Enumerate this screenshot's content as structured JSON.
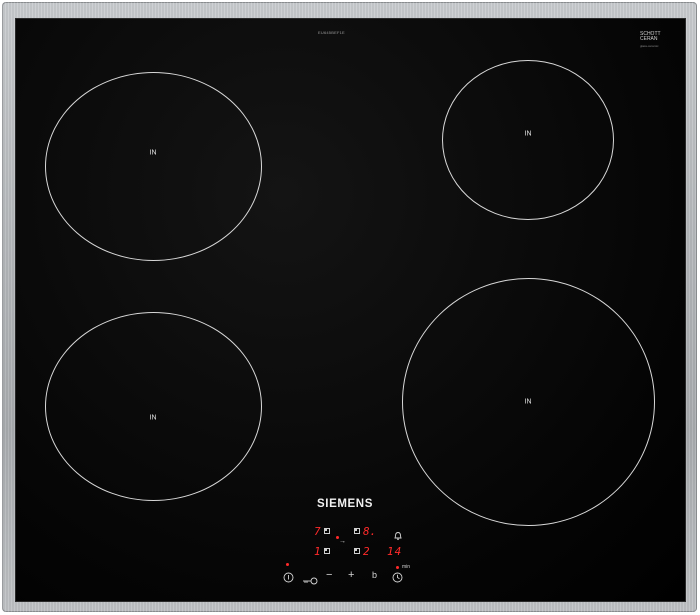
{
  "model_number": "EU645BEF1E",
  "glass_brand": {
    "line1": "SCHOTT",
    "line2": "CERAN",
    "line3": "glass-ceramic"
  },
  "zones": [
    {
      "label": "IN"
    },
    {
      "label": "IN"
    },
    {
      "label": "IN"
    },
    {
      "label": "IN"
    }
  ],
  "brand": "SIEMENS",
  "display": {
    "top_left_digit": "7",
    "top_right_digit": "8.",
    "bottom_left_digit": "1",
    "bottom_right_digit": "2",
    "timer_digits": "14",
    "timer_unit": "min"
  },
  "controls": {
    "power_icon": "power-icon",
    "child_lock_icon": "key-icon",
    "minus": "−",
    "plus": "+",
    "boost": "b",
    "timer_icon": "clock-icon",
    "alarm_icon": "bell-icon"
  }
}
